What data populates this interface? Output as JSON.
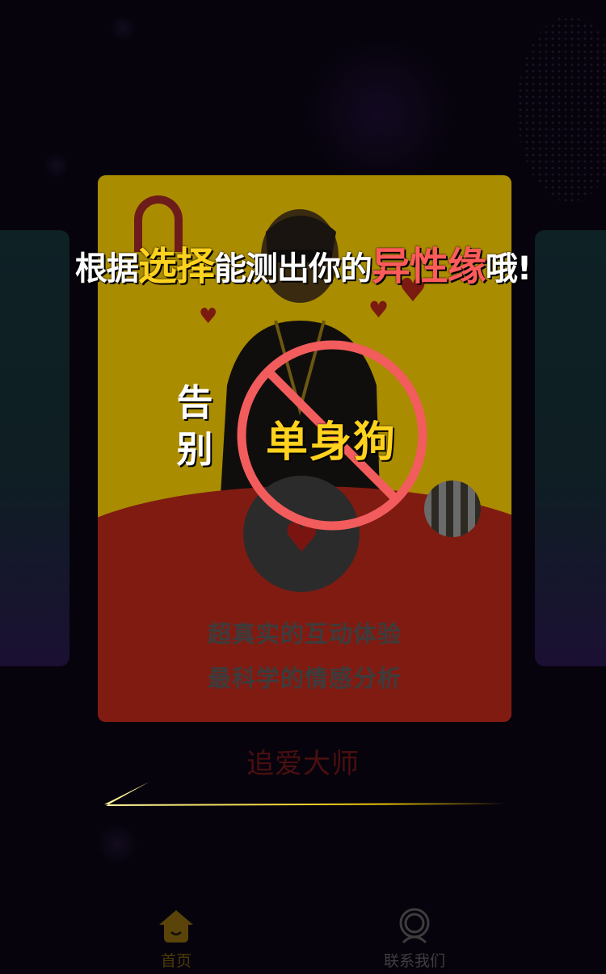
{
  "headline": {
    "part1": "根据",
    "highlight1": "选择",
    "part2": "能测出你的",
    "highlight2": "异性缘",
    "part3": "哦!"
  },
  "banner": {
    "farewell_char1": "告",
    "farewell_char2": "别",
    "crossed_text": "单身狗"
  },
  "card": {
    "line1": "超真实的互动体验",
    "line2": "最科学的情感分析"
  },
  "carousel": {
    "slide_title": "追爱大师"
  },
  "tabbar": {
    "home_label": "首页",
    "contact_label": "联系我们",
    "home_icon": "home-icon",
    "contact_icon": "user-icon"
  },
  "colors": {
    "background": "#07030d",
    "accent_yellow": "#ffd21e",
    "accent_red": "#ff5b5b",
    "card_yellow": "#aa8c00",
    "card_red": "#801b12"
  }
}
